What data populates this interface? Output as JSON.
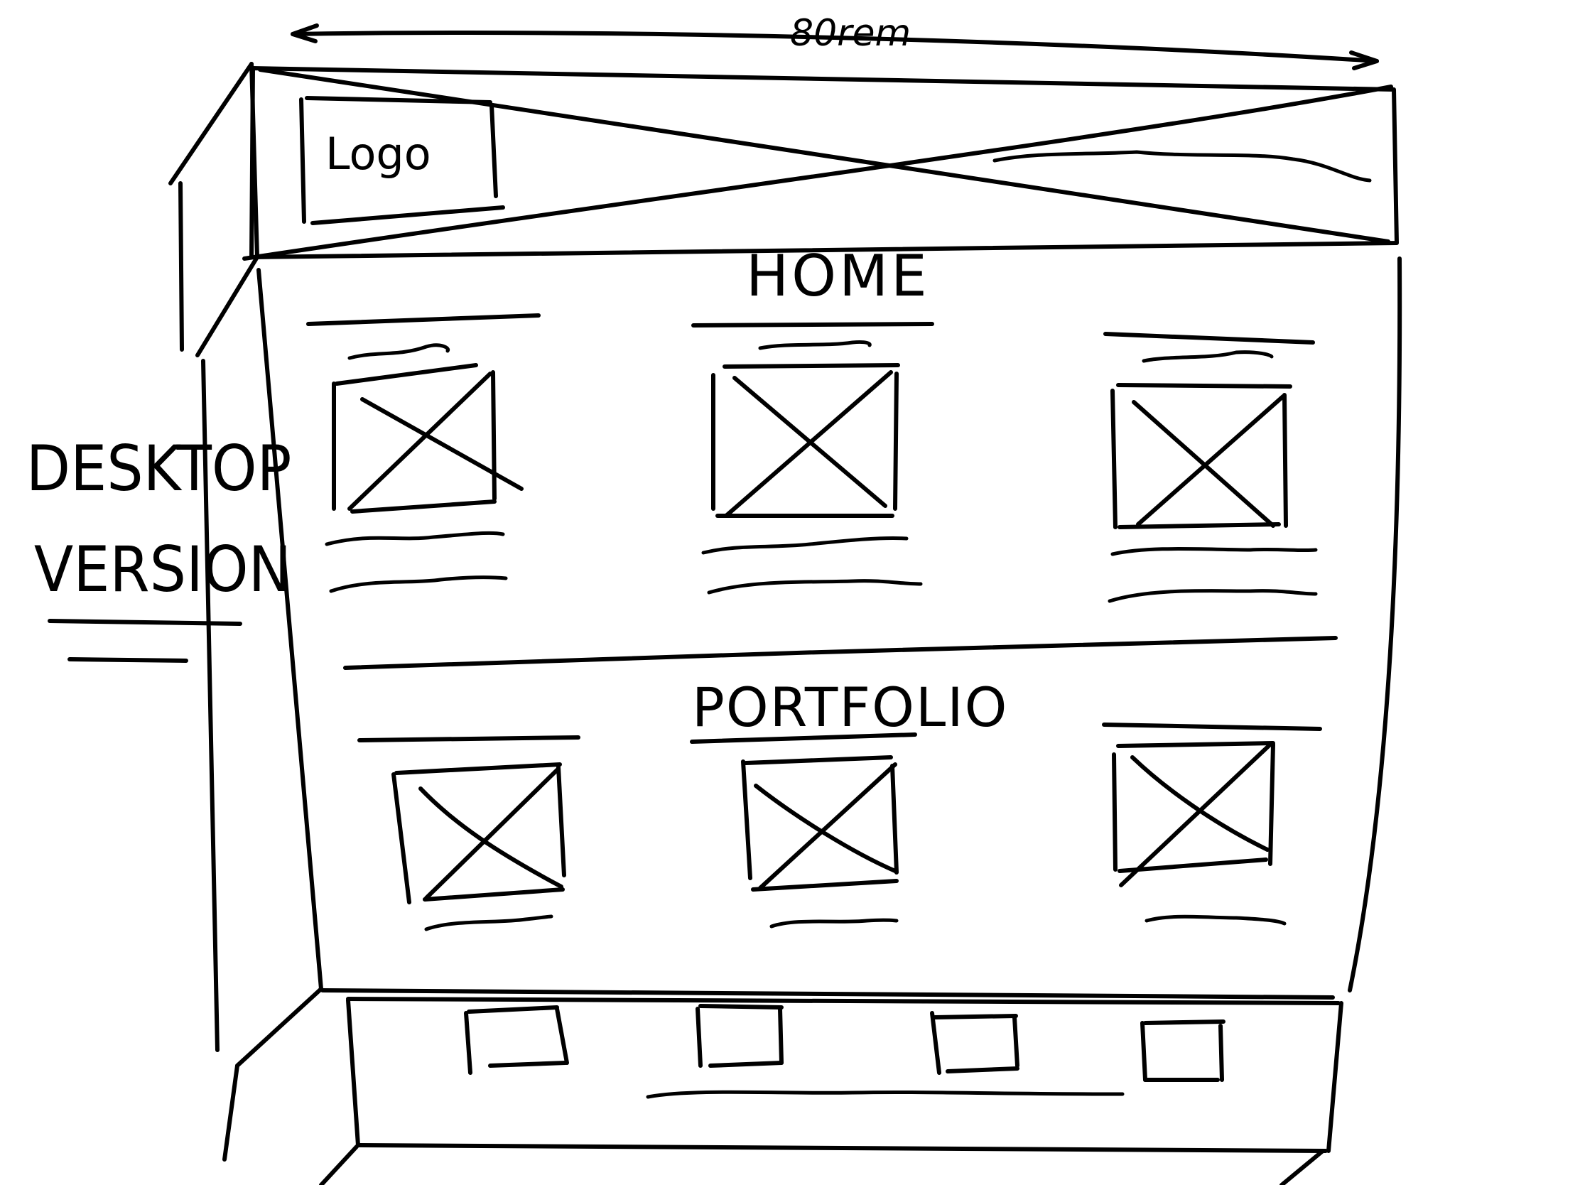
{
  "sketch": {
    "width_annotation": "80rem",
    "logo_label": "Logo",
    "home_heading": "HOME",
    "portfolio_heading": "PORTFOLIO",
    "side_label_line1": "DESKTOP",
    "side_label_line2": "VERSION"
  },
  "colors": {
    "ink": "#000000",
    "paper": "#ffffff"
  }
}
